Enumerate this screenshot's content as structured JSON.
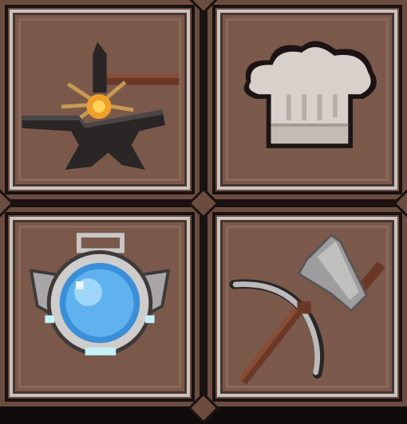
{
  "grid": {
    "tiles": [
      {
        "id": "smithing",
        "icon": "anvil-icon"
      },
      {
        "id": "cooking",
        "icon": "chef-hat-icon"
      },
      {
        "id": "alchemy",
        "icon": "potion-flask-icon"
      },
      {
        "id": "gathering",
        "icon": "pickaxe-cleaver-icon"
      }
    ]
  },
  "colors": {
    "tile_background": "#7a594b",
    "frame": "#c7c3c0",
    "seam": "#1a1110"
  }
}
